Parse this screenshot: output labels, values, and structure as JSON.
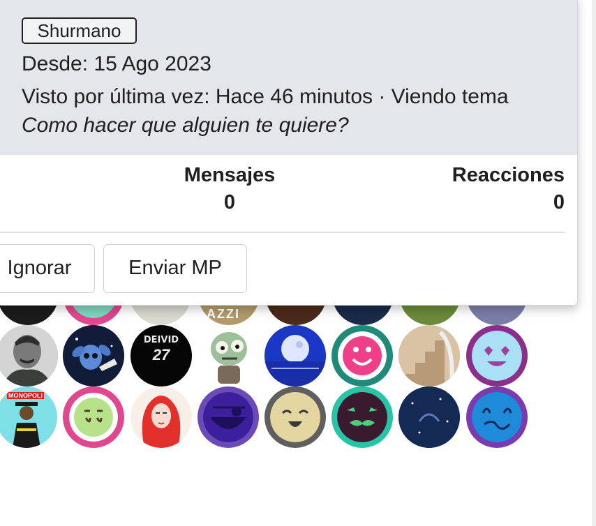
{
  "profile": {
    "user_title": "Shurmano",
    "joined": "Desde: 15 Ago 2023",
    "last_seen": "Visto por última vez: Hace 46 minutos · Viendo tema",
    "activity_thread": "Como hacer que alguien te quiere?"
  },
  "stats": {
    "first_label_partial": "º",
    "messages_label": "Mensajes",
    "messages_value": "0",
    "reactions_label": "Reacciones",
    "reactions_value": "0"
  },
  "actions": {
    "ignore_label": "Ignorar",
    "pm_label": "Enviar MP"
  },
  "avatars": {
    "texts": {
      "deivid_line1": "DEIVID",
      "deivid_line2": "27",
      "monopoli": "MONOPOLI",
      "azzi": "AZZI"
    },
    "colors": {
      "pink_ring": "#e0478f",
      "teal_ring": "#1f8a7a",
      "purple_ring": "#8a2f8a",
      "lavender_ring": "#6b4bb8",
      "indigo_bg": "#3c1f9a",
      "dark_gray_ring": "#5f5f5f"
    }
  }
}
